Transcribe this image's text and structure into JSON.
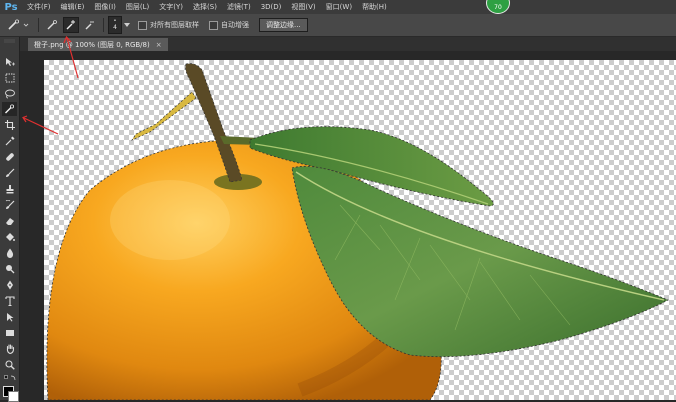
{
  "app": {
    "logo": "Ps"
  },
  "menu": {
    "items": [
      "文件(F)",
      "编辑(E)",
      "图像(I)",
      "图层(L)",
      "文字(Y)",
      "选择(S)",
      "滤镜(T)",
      "3D(D)",
      "视图(V)",
      "窗口(W)",
      "帮助(H)"
    ],
    "badge": "70"
  },
  "options": {
    "brush_size": "4",
    "sample_all_layers": "对所有图层取样",
    "auto_enhance": "自动增强",
    "refine_edge": "调整边缘..."
  },
  "document": {
    "tab_title": "橙子.png @ 100% (图层 0, RGB/8)",
    "close_glyph": "×"
  },
  "colors": {
    "accent_logo": "#5fb6f0",
    "annotation_arrow": "#e03030",
    "badge": "#2ea043"
  }
}
